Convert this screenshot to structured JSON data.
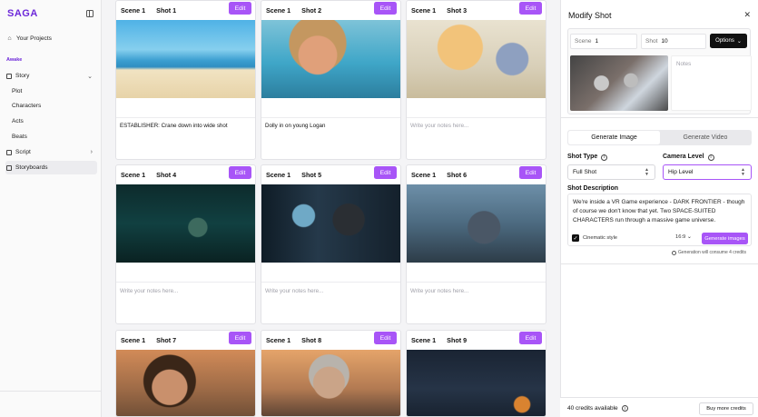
{
  "app": {
    "logo": "SAGA"
  },
  "sidebar": {
    "your_projects": "Your Projects",
    "project_name": "Awake",
    "items": [
      {
        "label": "Story",
        "icon": "book-icon",
        "has_children": true,
        "expanded": true
      },
      {
        "label": "Plot"
      },
      {
        "label": "Characters"
      },
      {
        "label": "Acts"
      },
      {
        "label": "Beats"
      },
      {
        "label": "Script",
        "icon": "document-icon",
        "has_children": true
      },
      {
        "label": "Storyboards",
        "icon": "storyboard-icon",
        "active": true
      }
    ]
  },
  "cards": [
    {
      "scene": "Scene 1",
      "shot": "Shot 1",
      "edit": "Edit",
      "note": "ESTABLISHER: Crane down into wide shot",
      "image": "beach"
    },
    {
      "scene": "Scene 1",
      "shot": "Shot 2",
      "edit": "Edit",
      "note": "Dolly in on young Logan",
      "image": "boy"
    },
    {
      "scene": "Scene 1",
      "shot": "Shot 3",
      "edit": "Edit",
      "note_placeholder": "Write your notes here...",
      "image": "girl"
    },
    {
      "scene": "Scene 1",
      "shot": "Shot 4",
      "edit": "Edit",
      "note_placeholder": "Write your notes here...",
      "image": "sleep"
    },
    {
      "scene": "Scene 1",
      "shot": "Shot 5",
      "edit": "Edit",
      "note_placeholder": "Write your notes here...",
      "image": "door"
    },
    {
      "scene": "Scene 1",
      "shot": "Shot 6",
      "edit": "Edit",
      "note_placeholder": "Write your notes here...",
      "image": "lab"
    },
    {
      "scene": "Scene 1",
      "shot": "Shot 7",
      "edit": "Edit",
      "image": "woman"
    },
    {
      "scene": "Scene 1",
      "shot": "Shot 8",
      "edit": "Edit",
      "image": "oldman"
    },
    {
      "scene": "Scene 1",
      "shot": "Shot 9",
      "edit": "Edit",
      "image": "room"
    }
  ],
  "panel": {
    "title": "Modify Shot",
    "scene_label": "Scene",
    "scene_value": "1",
    "shot_label": "Shot",
    "shot_value": "10",
    "options_label": "Options",
    "notes_placeholder": "Notes",
    "tabs": [
      "Generate Image",
      "Generate Video"
    ],
    "shot_type_label": "Shot Type",
    "shot_type_value": "Full Shot",
    "camera_level_label": "Camera Level",
    "camera_level_value": "Hip Level",
    "shot_description_label": "Shot Description",
    "shot_description": "We're inside a VR Game experience - DARK FRONTIER - though of course we don't know that yet. Two SPACE-SUITED CHARACTERS run through a massive game universe.",
    "cinematic_style": "Cinematic style",
    "aspect_ratio": "16:9",
    "generate_images": "Generate images",
    "credits_note": "Generation will consume 4 credits",
    "credits_available": "40 credits available",
    "buy_more": "Buy more credits"
  },
  "colors": {
    "accent": "#a855f7",
    "brand": "#6d28d9"
  }
}
